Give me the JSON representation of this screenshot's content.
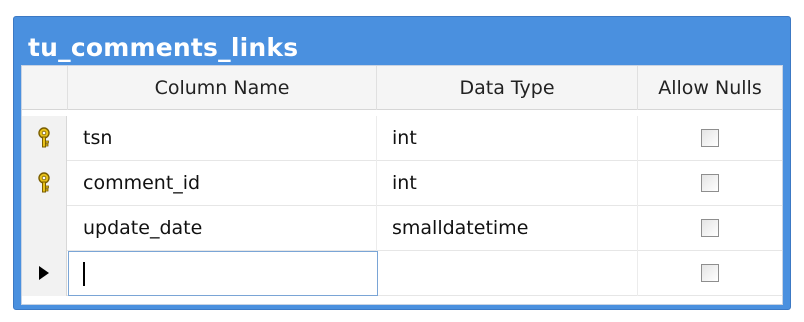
{
  "table_name": "tu_comments_links",
  "columns_header": {
    "column_name": "Column Name",
    "data_type": "Data Type",
    "allow_nulls": "Allow Nulls"
  },
  "rows": [
    {
      "column_name": "tsn",
      "data_type": "int",
      "allow_nulls": false,
      "primary_key": true
    },
    {
      "column_name": "comment_id",
      "data_type": "int",
      "allow_nulls": false,
      "primary_key": true
    },
    {
      "column_name": "update_date",
      "data_type": "smalldatetime",
      "allow_nulls": false,
      "primary_key": false
    },
    {
      "column_name": "",
      "data_type": "",
      "allow_nulls": false,
      "primary_key": false,
      "current": true
    }
  ],
  "colors": {
    "title_bar": "#4a90df",
    "key_icon": "#d9b300"
  },
  "icons": {
    "primary_key": "key-icon",
    "current_row": "row-pointer-icon"
  }
}
